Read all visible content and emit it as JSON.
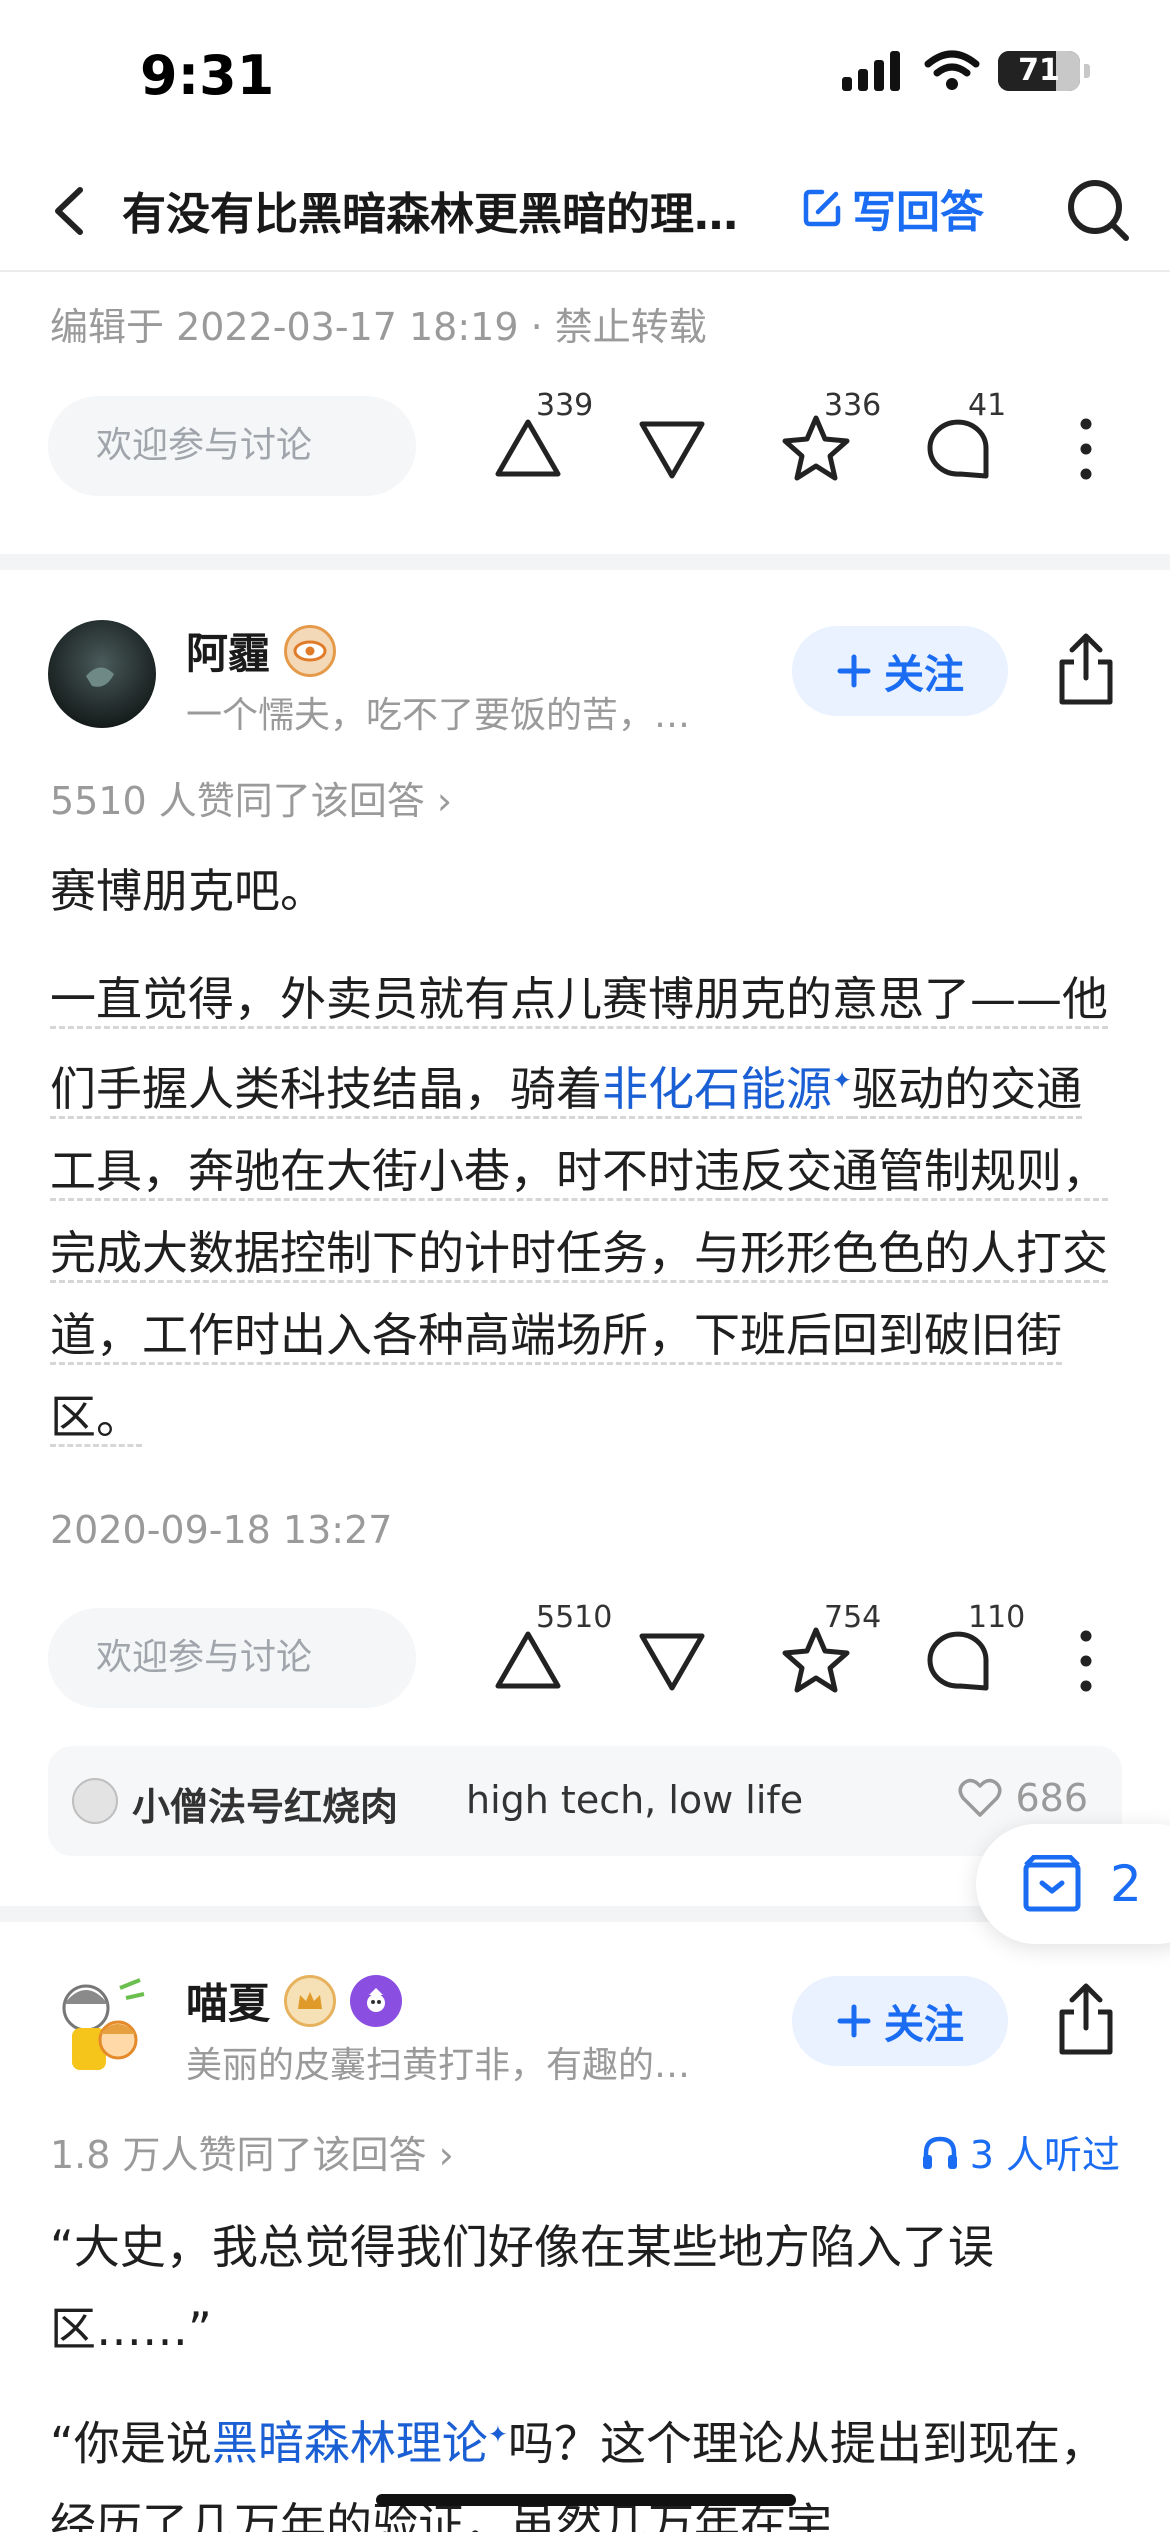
{
  "status_bar": {
    "time": "9:31",
    "battery": "71"
  },
  "header": {
    "title": "有没有比黑暗森林更黑暗的理…",
    "write_answer": "写回答"
  },
  "answer1": {
    "meta": "编辑于 2022-03-17 18:19 · 禁止转载",
    "discuss_placeholder": "欢迎参与讨论",
    "upvotes": "339",
    "favorites": "336",
    "comments": "41"
  },
  "answer2": {
    "author": "阿霾",
    "bio": "一个懦夫，吃不了要饭的苦，…",
    "follow": "关注",
    "agree": "5510 人赞同了该回答 ›",
    "para1": "赛博朋克吧。",
    "para2_a": "一直觉得，外卖员就有点儿赛博朋克的意思了——他们手握人类科技结晶，骑着",
    "para2_link": "非化石能源",
    "para2_b": "驱动的交通工具，奔驰在大街小巷，时不时违反交通管制规则，完成大数据控制下的计时任务，与形形色色的人打交道，工作时出入各种高端场所，下班后回到破旧街区。",
    "date": "2020-09-18 13:27",
    "discuss_placeholder": "欢迎参与讨论",
    "upvotes": "5510",
    "favorites": "754",
    "comments": "110",
    "top_comment": {
      "user": "小僧法号红烧肉",
      "text": "high tech, low life",
      "likes": "686"
    }
  },
  "float_collect": {
    "count": "2"
  },
  "answer3": {
    "author": "喵夏",
    "bio": "美丽的皮囊扫黄打非，有趣的…",
    "follow": "关注",
    "agree": "1.8 万人赞同了该回答 ›",
    "listened": "3 人听过",
    "para1": "“大史，我总觉得我们好像在某些地方陷入了误区……”",
    "para2_a": "“你是说",
    "para2_link": "黑暗森林理论",
    "para2_b": "吗？这个理论从提出到现在，经历了几万年的验证，虽然几万年在宇"
  }
}
